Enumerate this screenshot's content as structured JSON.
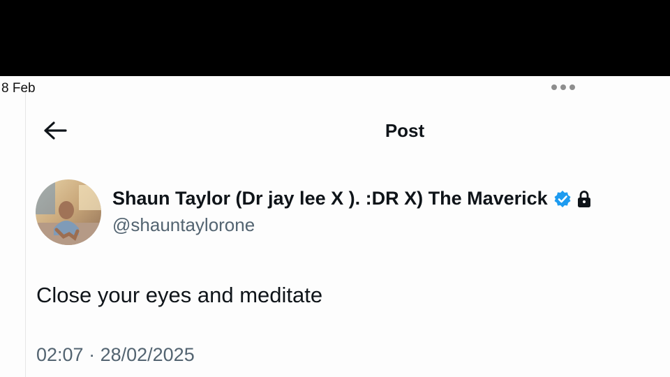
{
  "status_bar": {
    "date": "8 Feb",
    "more_icon": "more-dots-icon"
  },
  "header": {
    "back_icon": "arrow-left-icon",
    "title": "Post"
  },
  "author": {
    "display_name": "Shaun Taylor (Dr jay lee X ). :DR X) The Maverick",
    "handle": "@shauntaylorone",
    "verified_icon": "verified-badge-icon",
    "verified_color": "#1d9bf0",
    "protected_icon": "lock-icon"
  },
  "post": {
    "text": "Close your eyes and meditate",
    "time": "02:07",
    "separator": " · ",
    "date": "28/02/2025"
  },
  "colors": {
    "text_primary": "#0f1419",
    "text_secondary": "#536471"
  }
}
